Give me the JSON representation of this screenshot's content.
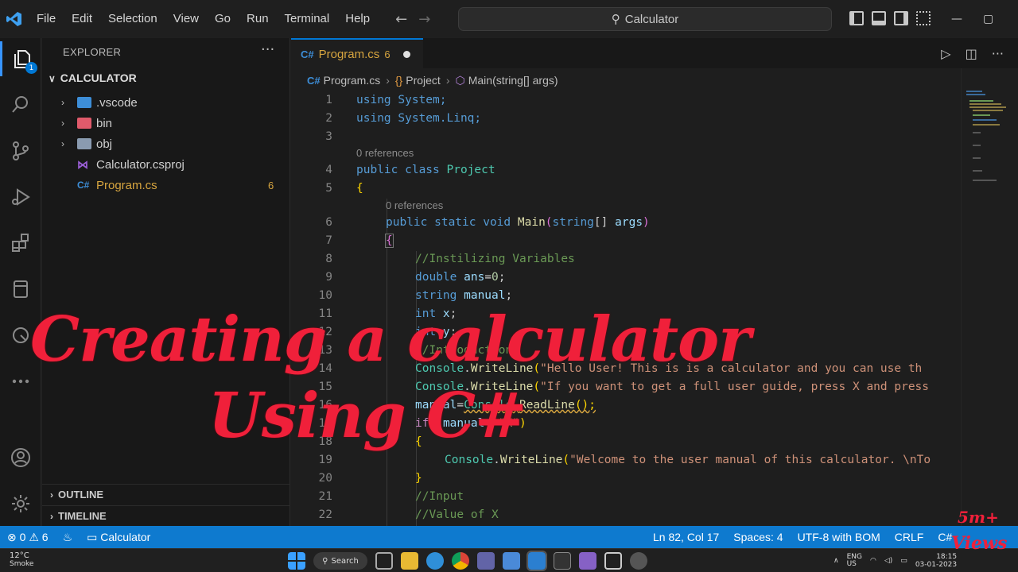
{
  "titlebar": {
    "menu": [
      "File",
      "Edit",
      "Selection",
      "View",
      "Go",
      "Run",
      "Terminal",
      "Help"
    ],
    "search": "Calculator"
  },
  "activity": {
    "explorer_badge": "1"
  },
  "sidebar": {
    "title": "EXPLORER",
    "folder": "CALCULATOR",
    "items": [
      {
        "label": ".vscode",
        "icon": "folder-vscode-icon",
        "color": "#3d8ed8"
      },
      {
        "label": "bin",
        "icon": "folder-bin-icon",
        "color": "#e05a6b"
      },
      {
        "label": "obj",
        "icon": "folder-icon",
        "color": "#8a9bb0"
      },
      {
        "label": "Calculator.csproj",
        "icon": "csproj-icon",
        "color": "#9b5fd6"
      },
      {
        "label": "Program.cs",
        "icon": "csharp-file-icon",
        "color": "#3d8ed8",
        "count": "6"
      }
    ],
    "outline": "OUTLINE",
    "timeline": "TIMELINE"
  },
  "editor": {
    "tab": {
      "lang": "C#",
      "name": "Program.cs",
      "count": "6"
    },
    "breadcrumb": {
      "lang": "C#",
      "file": "Program.cs",
      "class": "Project",
      "method": "Main(string[] args)"
    },
    "refs": [
      "0 references",
      "0 references"
    ],
    "line_numbers": [
      "1",
      "2",
      "3",
      "4",
      "5",
      "6",
      "7",
      "8",
      "9",
      "10",
      "11",
      "12",
      "13",
      "14",
      "15",
      "16",
      "17",
      "18",
      "19",
      "20",
      "21",
      "22"
    ],
    "lines": {
      "l1": "using System;",
      "l2": "using System.Linq;",
      "l4a": "public class ",
      "l4b": "Project",
      "l5": "{",
      "l6a": "public static void ",
      "l6b": "Main",
      "l6c": "(",
      "l6d": "string",
      "l6e": "[] ",
      "l6f": "args",
      "l6g": ")",
      "l7": "{",
      "l8": "//Instilizing Variables",
      "l9a": "double ",
      "l9b": "ans",
      "l9c": "=",
      "l9d": "0",
      "l9e": ";",
      "l10a": "string ",
      "l10b": "manual",
      "l10c": ";",
      "l11a": "int ",
      "l11b": "x",
      "l11c": ";",
      "l12a": "int ",
      "l12b": "y",
      "l12c": ";",
      "l13": "//Introduction",
      "l14a": "Console",
      "l14b": ".",
      "l14c": "WriteLine",
      "l14d": "(",
      "l14e": "\"Hello User! This is is a calculator and you can use th",
      "l15a": "Console",
      "l15b": ".",
      "l15c": "WriteLine",
      "l15d": "(",
      "l15e": "\"If you want to get a full user guide, press X and press",
      "l16a": "manual",
      "l16b": "=",
      "l16c": "Console",
      "l16d": ".",
      "l16e": "ReadLine",
      "l16f": "();",
      "l17a": "if ",
      "l17b": "(",
      "l17c": "manual",
      "l17d": "==",
      "l17e": "\"X\"",
      "l17f": ")",
      "l18": "{",
      "l19a": "Console",
      "l19b": ".",
      "l19c": "WriteLine",
      "l19d": "(",
      "l19e": "\"Welcome to the user manual of this calculator. \\nTo",
      "l20": "}",
      "l21": "//Input",
      "l22": "//Value of X"
    }
  },
  "statusbar": {
    "errors": "0",
    "warnings": "6",
    "folder": "Calculator",
    "position": "Ln 82, Col 17",
    "spaces": "Spaces: 4",
    "encoding": "UTF-8 with BOM",
    "eol": "CRLF",
    "lang": "C#"
  },
  "taskbar": {
    "temp": "12°C",
    "weather": "Smoke",
    "search": "Search",
    "lang": "ENG",
    "region": "US",
    "time": "18:15",
    "date": "03-01-2023"
  },
  "overlay": {
    "line1": "Creating a calculator",
    "line2": "Using C#",
    "views1": "5m+",
    "views2": "Views"
  },
  "colors": {
    "accent": "#0078d4",
    "statusbar": "#0e7acf",
    "overlay_text": "#f0203a",
    "warning_file": "#d7a53f"
  }
}
